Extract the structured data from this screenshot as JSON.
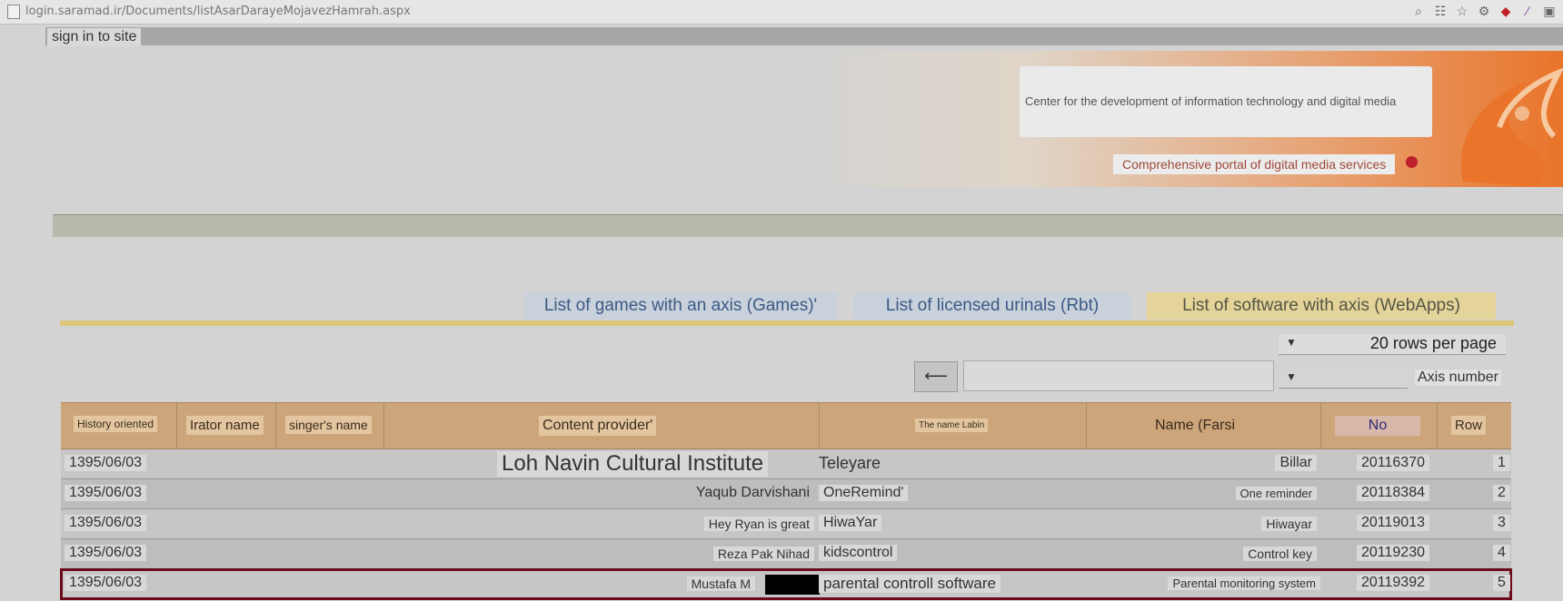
{
  "browser": {
    "url": "login.saramad.ir/Documents/listAsarDarayeMojavezHamrah.aspx"
  },
  "nav": {
    "signin_label": "sign in to site"
  },
  "header": {
    "center_name": "Center for the development of information technology and digital media",
    "portal_label": "Comprehensive portal of digital media services"
  },
  "tabs": [
    {
      "label": "List of games with an axis (Games)'"
    },
    {
      "label": "List of licensed urinals (Rbt)"
    },
    {
      "label": "List of software with axis (WebApps)"
    }
  ],
  "controls": {
    "rows_per_page": "20 rows per page",
    "search_button": "⟵",
    "axis_label": "Axis number"
  },
  "table": {
    "headers": {
      "history": "History oriented",
      "narrator": "Irator name",
      "singer": "singer's name",
      "provider": "Content provider'",
      "latin": "The name Labin",
      "farsi": "Name (Farsi",
      "no": "No",
      "row": "Row"
    },
    "rows": [
      {
        "date": "1395/06/03",
        "provider": "Loh Navin Cultural Institute",
        "latin": "Teleyare",
        "farsi": "Billar",
        "no": "20116370",
        "row": "1"
      },
      {
        "date": "1395/06/03",
        "provider": "Yaqub Darvishani",
        "latin": "OneRemind'",
        "farsi": "One reminder",
        "no": "20118384",
        "row": "2"
      },
      {
        "date": "1395/06/03",
        "provider": "Hey Ryan is great",
        "latin": "HiwaYar",
        "farsi": "Hiwayar",
        "no": "20119013",
        "row": "3"
      },
      {
        "date": "1395/06/03",
        "provider": "Reza Pak Nihad",
        "latin": "kidscontrol",
        "farsi": "Control key",
        "no": "20119230",
        "row": "4"
      },
      {
        "date": "1395/06/03",
        "provider": "Mustafa M",
        "latin": "parental controll software",
        "farsi": "Parental monitoring system",
        "no": "20119392",
        "row": "5"
      }
    ]
  },
  "colors": {
    "accent": "#e9742a",
    "header_row": "#cda57a",
    "selected_row_border": "#6e0b1a"
  }
}
